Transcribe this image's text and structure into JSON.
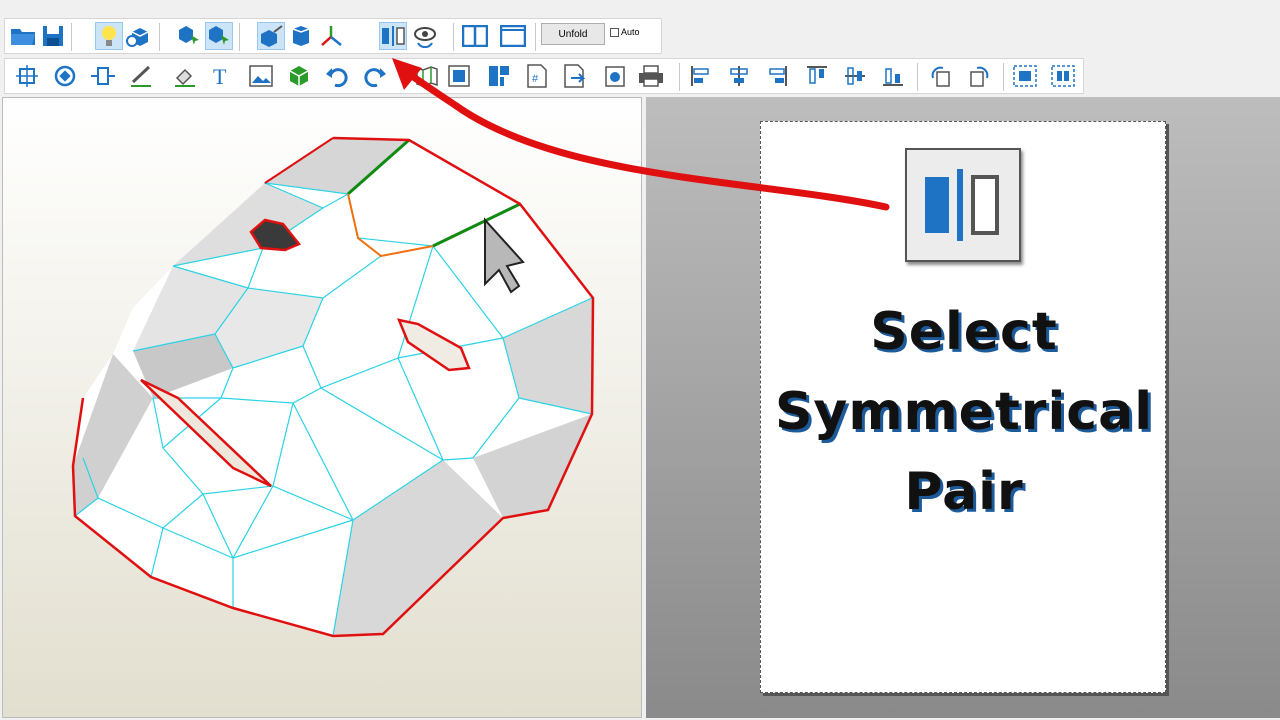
{
  "toolbar_top": {
    "buttons": [
      "open-file",
      "save-file",
      "light-toggle",
      "3d-view",
      "select-face",
      "select-part",
      "paint-face",
      "cylinder",
      "axes",
      "symmetrical-pair",
      "rotate-view",
      "split-view-vertical",
      "single-view"
    ],
    "unfold_label": "Unfold",
    "auto_label": "Auto",
    "auto_checked": false
  },
  "toolbar_bottom": {
    "buttons": [
      "move",
      "rotate",
      "resize",
      "pencil",
      "fill",
      "text",
      "image",
      "3d-box",
      "undo",
      "redo",
      "fold-line",
      "edge-tool",
      "frame",
      "page-layout",
      "page-number",
      "export",
      "snapshot",
      "print",
      "align-left",
      "align-center",
      "align-right",
      "align-top",
      "align-middle",
      "align-bottom",
      "rotate-left",
      "rotate-right",
      "group",
      "ungroup"
    ]
  },
  "callout": {
    "title_line1": "Select",
    "title_line2": "Symmetrical",
    "title_line3": "Pair",
    "icon": "symmetrical-pair-icon"
  },
  "colors": {
    "accent_blue": "#1f73c5",
    "edge_cut": "#e01010",
    "edge_fold": "#2bd3e6",
    "highlight_green": "#108a10",
    "highlight_orange": "#f07010",
    "arrow_red": "#e01010"
  }
}
